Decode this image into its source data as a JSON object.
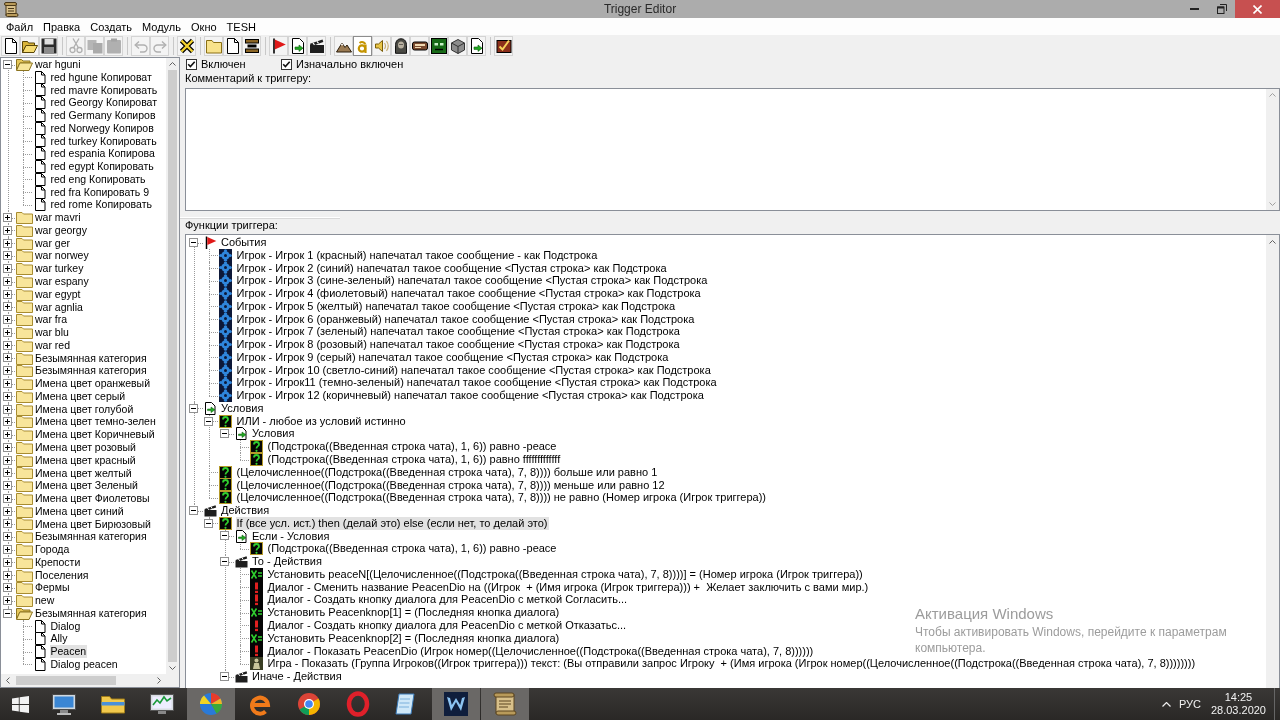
{
  "window": {
    "title": "Trigger Editor"
  },
  "menu": [
    "Файл",
    "Правка",
    "Создать",
    "Модуль",
    "Окно",
    "TESH"
  ],
  "toolbar": [
    [
      {
        "kind": "new",
        "disabled": false,
        "on": false
      },
      {
        "kind": "open",
        "disabled": false,
        "on": false
      },
      {
        "kind": "save",
        "disabled": false,
        "on": false
      }
    ],
    [
      {
        "kind": "cut",
        "disabled": true,
        "on": false
      },
      {
        "kind": "copy",
        "disabled": true,
        "on": false
      },
      {
        "kind": "paste",
        "disabled": true,
        "on": false
      }
    ],
    [
      {
        "kind": "undo",
        "disabled": true,
        "on": false
      },
      {
        "kind": "redo",
        "disabled": true,
        "on": false
      }
    ],
    [
      {
        "kind": "delete",
        "disabled": false,
        "on": false
      }
    ],
    [
      {
        "kind": "folder",
        "disabled": false,
        "on": false
      },
      {
        "kind": "document",
        "disabled": false,
        "on": false
      },
      {
        "kind": "comment",
        "disabled": false,
        "on": false
      }
    ],
    [
      {
        "kind": "event",
        "disabled": false,
        "on": false
      },
      {
        "kind": "condition",
        "disabled": false,
        "on": false
      },
      {
        "kind": "action",
        "disabled": false,
        "on": false
      }
    ],
    [
      {
        "kind": "terrain",
        "disabled": false,
        "on": false
      },
      {
        "kind": "text",
        "disabled": false,
        "on": true
      },
      {
        "kind": "sound",
        "disabled": false,
        "on": false
      },
      {
        "kind": "unit",
        "disabled": false,
        "on": false
      },
      {
        "kind": "panel",
        "disabled": false,
        "on": false
      },
      {
        "kind": "creature",
        "disabled": false,
        "on": false
      },
      {
        "kind": "object",
        "disabled": false,
        "on": false
      },
      {
        "kind": "import",
        "disabled": false,
        "on": false
      }
    ],
    [
      {
        "kind": "test",
        "disabled": false,
        "on": false
      }
    ]
  ],
  "categories": [
    {
      "label": "war hguni",
      "expanded": true,
      "selected": false,
      "children": [
        {
          "label": "red hgune Копироват",
          "selected": false
        },
        {
          "label": "red mavre Копировать",
          "selected": false
        },
        {
          "label": "red Georgy Копироват",
          "selected": false
        },
        {
          "label": "red Germany Копиров",
          "selected": false
        },
        {
          "label": "red Norwegy Копиров",
          "selected": false
        },
        {
          "label": "red turkey Копировать",
          "selected": false
        },
        {
          "label": "red espania Копирова",
          "selected": false
        },
        {
          "label": "red egypt Копировать",
          "selected": false
        },
        {
          "label": "red eng Копировать",
          "selected": false
        },
        {
          "label": "red fra Копировать 9",
          "selected": false
        },
        {
          "label": "red rome Копировать",
          "selected": false
        }
      ]
    },
    {
      "label": "war mavri",
      "expanded": false,
      "selected": false
    },
    {
      "label": "war georgy",
      "expanded": false,
      "selected": false
    },
    {
      "label": "war ger",
      "expanded": false,
      "selected": false
    },
    {
      "label": "war norwey",
      "expanded": false,
      "selected": false
    },
    {
      "label": "war turkey",
      "expanded": false,
      "selected": false
    },
    {
      "label": "war espany",
      "expanded": false,
      "selected": false
    },
    {
      "label": "war egypt",
      "expanded": false,
      "selected": false
    },
    {
      "label": "war agnlia",
      "expanded": false,
      "selected": false
    },
    {
      "label": "war fra",
      "expanded": false,
      "selected": false
    },
    {
      "label": "war blu",
      "expanded": false,
      "selected": false
    },
    {
      "label": "war red",
      "expanded": false,
      "selected": false
    },
    {
      "label": "Безымянная категория",
      "expanded": false,
      "selected": false
    },
    {
      "label": "Безымянная категория",
      "expanded": false,
      "selected": false
    },
    {
      "label": "Имена цвет оранжевый",
      "expanded": false,
      "selected": false
    },
    {
      "label": "Имена цвет серый",
      "expanded": false,
      "selected": false
    },
    {
      "label": "Имена цвет голубой",
      "expanded": false,
      "selected": false
    },
    {
      "label": "Имена цвет темно-зелен",
      "expanded": false,
      "selected": false
    },
    {
      "label": "Имена цвет Коричневый",
      "expanded": false,
      "selected": false
    },
    {
      "label": "Имена цвет розовый",
      "expanded": false,
      "selected": false
    },
    {
      "label": "Имена цвет красный",
      "expanded": false,
      "selected": false
    },
    {
      "label": "Имена цвет желтый",
      "expanded": false,
      "selected": false
    },
    {
      "label": "Имена цвет Зеленый",
      "expanded": false,
      "selected": false
    },
    {
      "label": "Имена цвет Фиолетовы",
      "expanded": false,
      "selected": false
    },
    {
      "label": "Имена цвет синий",
      "expanded": false,
      "selected": false
    },
    {
      "label": "Имена цвет Бирюзовый",
      "expanded": false,
      "selected": false
    },
    {
      "label": "Безымянная категория",
      "expanded": false,
      "selected": false
    },
    {
      "label": "Города",
      "expanded": false,
      "selected": false
    },
    {
      "label": "Крепости",
      "expanded": false,
      "selected": false
    },
    {
      "label": "Поселения",
      "expanded": false,
      "selected": false
    },
    {
      "label": "Фермы",
      "expanded": false,
      "selected": false
    },
    {
      "label": "new",
      "expanded": false,
      "selected": false
    },
    {
      "label": "Безымянная категория",
      "expanded": true,
      "selected": false,
      "children": [
        {
          "label": "Dialog",
          "selected": false
        },
        {
          "label": "Ally",
          "selected": false
        },
        {
          "label": "Peacen",
          "selected": true
        },
        {
          "label": "Dialog peacen",
          "selected": false
        }
      ]
    }
  ],
  "options": [
    {
      "label": "Включен",
      "checked": true
    },
    {
      "label": "Изначально включен",
      "checked": true
    }
  ],
  "comment_label": "Комментарий к триггеру:",
  "functions_label": "Функции триггера:",
  "functions": [
    {
      "kind": "events",
      "label": "События",
      "expanded": true,
      "selected": false,
      "children": [
        {
          "kind": "event",
          "label": "Игрок - Игрок 1 (красный) напечатал такое сообщение - как Подстрока",
          "selected": false
        },
        {
          "kind": "event",
          "label": "Игрок - Игрок 2 (синий) напечатал такое сообщение <Пустая строка> как Подстрока",
          "selected": false
        },
        {
          "kind": "event",
          "label": "Игрок - Игрок 3 (сине-зеленый) напечатал такое сообщение <Пустая строка> как Подстрока",
          "selected": false
        },
        {
          "kind": "event",
          "label": "Игрок - Игрок 4 (фиолетовый) напечатал такое сообщение <Пустая строка> как Подстрока",
          "selected": false
        },
        {
          "kind": "event",
          "label": "Игрок - Игрок 5 (желтый) напечатал такое сообщение <Пустая строка> как Подстрока",
          "selected": false
        },
        {
          "kind": "event",
          "label": "Игрок - Игрок 6 (оранжевый) напечатал такое сообщение <Пустая строка> как Подстрока",
          "selected": false
        },
        {
          "kind": "event",
          "label": "Игрок - Игрок 7 (зеленый) напечатал такое сообщение <Пустая строка> как Подстрока",
          "selected": false
        },
        {
          "kind": "event",
          "label": "Игрок - Игрок 8 (розовый) напечатал такое сообщение <Пустая строка> как Подстрока",
          "selected": false
        },
        {
          "kind": "event",
          "label": "Игрок - Игрок 9 (серый) напечатал такое сообщение <Пустая строка> как Подстрока",
          "selected": false
        },
        {
          "kind": "event",
          "label": "Игрок - Игрок 10 (светло-синий) напечатал такое сообщение <Пустая строка> как Подстрока",
          "selected": false
        },
        {
          "kind": "event",
          "label": "Игрок - Игрок11 (темно-зеленый) напечатал такое сообщение <Пустая строка> как Подстрока",
          "selected": false
        },
        {
          "kind": "event",
          "label": "Игрок - Игрок 12 (коричневый) напечатал такое сообщение <Пустая строка> как Подстрока",
          "selected": false
        }
      ]
    },
    {
      "kind": "conditions",
      "label": "Условия",
      "expanded": true,
      "selected": false,
      "children": [
        {
          "kind": "condition",
          "label": "ИЛИ - любое из условий истинно",
          "expanded": true,
          "selected": false,
          "children": [
            {
              "kind": "conditions",
              "label": "Условия",
              "expanded": true,
              "selected": false,
              "children": [
                {
                  "kind": "condition",
                  "label": "(Подстрока((Введенная строка чата), 1, 6)) равно -peace",
                  "selected": false
                },
                {
                  "kind": "condition",
                  "label": "(Подстрока((Введенная строка чата), 1, 6)) равно fffffffffffff",
                  "selected": false
                }
              ]
            }
          ]
        },
        {
          "kind": "condition",
          "label": "(Целочисленное((Подстрока((Введенная строка чата), 7, 8)))) больше или равно 1",
          "selected": false
        },
        {
          "kind": "condition",
          "label": "(Целочисленное((Подстрока((Введенная строка чата), 7, 8)))) меньше или равно 12",
          "selected": false
        },
        {
          "kind": "condition",
          "label": "(Целочисленное((Подстрока((Введенная строка чата), 7, 8)))) не равно (Номер игрока (Игрок триггера))",
          "selected": false
        }
      ]
    },
    {
      "kind": "actions",
      "label": "Действия",
      "expanded": true,
      "selected": false,
      "children": [
        {
          "kind": "condition",
          "label": "If (все усл. ист.) then (делай это) else (если нет, то делай это)",
          "expanded": true,
          "selected": true,
          "children": [
            {
              "kind": "conditions",
              "label": "Если - Условия",
              "expanded": true,
              "selected": false,
              "children": [
                {
                  "kind": "condition",
                  "label": "(Подстрока((Введенная строка чата), 1, 6)) равно -peace",
                  "selected": false
                }
              ]
            },
            {
              "kind": "actions",
              "label": "То - Действия",
              "expanded": true,
              "selected": false,
              "children": [
                {
                  "kind": "set",
                  "label": "Установить peaceN[(Целочисленное((Подстрока((Введенная строка чата), 7, 8))))] = (Номер игрока (Игрок триггера))",
                  "selected": false
                },
                {
                  "kind": "dialog",
                  "label": "Диалог - Сменить название PeacenDio на ((Игрок  + (Имя игрока (Игрок триггера))) +  Желает заключить с вами мир.)",
                  "selected": false
                },
                {
                  "kind": "dialog",
                  "label": "Диалог - Создать кнопку диалога для PeacenDio с меткой Согласить...",
                  "selected": false
                },
                {
                  "kind": "set",
                  "label": "Установить Peacenknop[1] = (Последняя кнопка диалога)",
                  "selected": false
                },
                {
                  "kind": "dialog",
                  "label": "Диалог - Создать кнопку диалога для PeacenDio с меткой Отказатьс...",
                  "selected": false
                },
                {
                  "kind": "set",
                  "label": "Установить Peacenknop[2] = (Последняя кнопка диалога)",
                  "selected": false
                },
                {
                  "kind": "dialog",
                  "label": "Диалог - Показать PeacenDio (Игрок номер((Целочисленное((Подстрока((Введенная строка чата), 7, 8))))))",
                  "selected": false
                },
                {
                  "kind": "game",
                  "label": "Игра - Показать (Группа Игроков((Игрок триггера))) текст: (Вы отправили запрос Игроку  + (Имя игрока (Игрок номер((Целочисленное((Подстрока((Введенная строка чата), 7, 8))))))))",
                  "selected": false
                }
              ]
            },
            {
              "kind": "actions",
              "label": "Иначе - Действия",
              "expanded": true,
              "selected": false
            }
          ]
        }
      ]
    }
  ],
  "activation_notice": {
    "title": "Активация Windows",
    "text": "Чтобы активировать Windows, перейдите к параметрам\nкомпьютера."
  },
  "taskbar": {
    "apps": [
      {
        "kind": "computer",
        "running": false
      },
      {
        "kind": "files",
        "running": false
      },
      {
        "kind": "perfmon",
        "running": false
      },
      {
        "kind": "sphere",
        "running": true
      },
      {
        "kind": "swirl",
        "running": false
      },
      {
        "kind": "wheel",
        "running": false
      },
      {
        "kind": "ring",
        "running": false
      },
      {
        "kind": "notepad",
        "running": false
      },
      {
        "kind": "emblem",
        "running": true
      },
      {
        "kind": "scroll",
        "running": true
      }
    ],
    "language": "РУС",
    "time": "14:25",
    "date": "28.03.2020"
  }
}
